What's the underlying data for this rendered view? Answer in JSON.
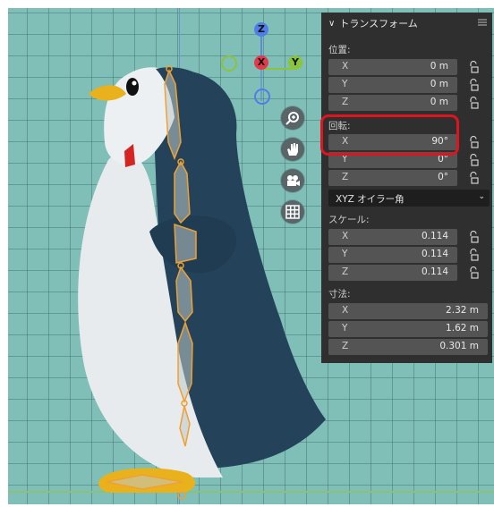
{
  "viewport": {
    "gizmo": {
      "z": "Z",
      "x": "X",
      "y": "Y"
    },
    "nav_icons": [
      "zoom-icon",
      "hand-pan-icon",
      "camera-icon",
      "grid-icon"
    ]
  },
  "transform_panel": {
    "title": "トランスフォーム",
    "location": {
      "label": "位置:",
      "fields": [
        {
          "axis": "X",
          "value": "0 m"
        },
        {
          "axis": "Y",
          "value": "0 m"
        },
        {
          "axis": "Z",
          "value": "0 m"
        }
      ]
    },
    "rotation": {
      "label": "回転:",
      "fields": [
        {
          "axis": "X",
          "value": "90°"
        },
        {
          "axis": "Y",
          "value": "0°"
        },
        {
          "axis": "Z",
          "value": "0°"
        }
      ],
      "mode": "XYZ オイラー角"
    },
    "scale": {
      "label": "スケール:",
      "fields": [
        {
          "axis": "X",
          "value": "0.114"
        },
        {
          "axis": "Y",
          "value": "0.114"
        },
        {
          "axis": "Z",
          "value": "0.114"
        }
      ]
    },
    "dimensions": {
      "label": "寸法:",
      "fields": [
        {
          "axis": "X",
          "value": "2.32 m"
        },
        {
          "axis": "Y",
          "value": "1.62 m"
        },
        {
          "axis": "Z",
          "value": "0.301 m"
        }
      ]
    }
  },
  "colors": {
    "grid_bg": "#7fbfb8",
    "panel_bg": "#2f2f2f",
    "highlight": "#e0141e",
    "bone": "#f0a030"
  }
}
